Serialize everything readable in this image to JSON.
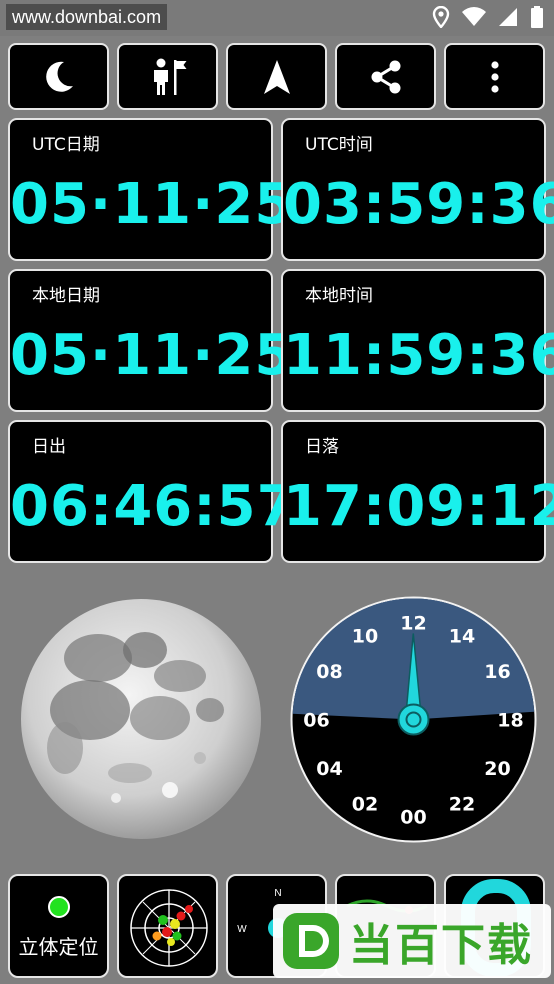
{
  "status_bar": {
    "watermark": "www.downbai.com",
    "icons": [
      "location-icon",
      "wifi-icon",
      "signal-icon",
      "battery-icon"
    ]
  },
  "toolbar": {
    "buttons": [
      {
        "name": "night-mode-button",
        "icon": "moon-icon"
      },
      {
        "name": "person-flag-button",
        "icon": "person-flag-icon"
      },
      {
        "name": "navigation-button",
        "icon": "navigation-arrow-icon"
      },
      {
        "name": "share-button",
        "icon": "share-icon"
      },
      {
        "name": "more-menu-button",
        "icon": "more-vertical-icon"
      }
    ]
  },
  "cards": {
    "utc_date": {
      "label": "UTC日期",
      "value": "05·11·25"
    },
    "utc_time": {
      "label": "UTC时间",
      "value": "03:59:36"
    },
    "local_date": {
      "label": "本地日期",
      "value": "05·11·25"
    },
    "local_time": {
      "label": "本地时间",
      "value": "11:59:36"
    },
    "sunrise": {
      "label": "日出",
      "value": "06:46:57"
    },
    "sunset": {
      "label": "日落",
      "value": "17:09:12"
    }
  },
  "dial": {
    "hour_labels": [
      "12",
      "14",
      "16",
      "18",
      "20",
      "22",
      "00",
      "02",
      "04",
      "06",
      "08",
      "10"
    ],
    "current_hour": 11.99
  },
  "bottom": {
    "stereo_label": "立体定位",
    "compass_labels": {
      "north": "N",
      "west": "W"
    }
  },
  "brand": {
    "text": "当百下载"
  },
  "colors": {
    "accent": "#19f0ec",
    "day": "#5b84bf",
    "night": "#000000",
    "background": "#7f7f7f"
  }
}
